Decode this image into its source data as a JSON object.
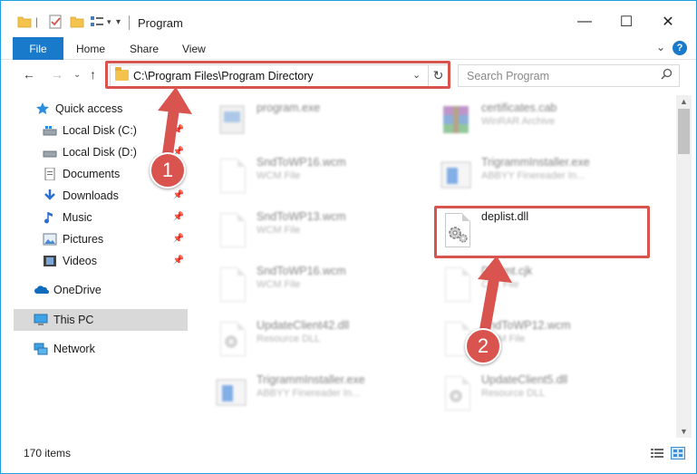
{
  "window": {
    "title": "Program",
    "minimize": "—",
    "maximize": "☐",
    "close": "✕"
  },
  "ribbon": {
    "tabs": [
      "File",
      "Home",
      "Share",
      "View"
    ],
    "help": "?"
  },
  "address": {
    "path": "C:\\Program Files\\Program Directory",
    "search_placeholder": "Search Program"
  },
  "nav": {
    "items": [
      {
        "label": "Quick access",
        "icon": "star-icon"
      },
      {
        "label": "Local Disk (C:)",
        "icon": "drive-icon"
      },
      {
        "label": "Local Disk (D:)",
        "icon": "drive-icon"
      },
      {
        "label": "Documents",
        "icon": "documents-icon"
      },
      {
        "label": "Downloads",
        "icon": "download-icon"
      },
      {
        "label": "Music",
        "icon": "music-icon"
      },
      {
        "label": "Pictures",
        "icon": "pictures-icon"
      },
      {
        "label": "Videos",
        "icon": "videos-icon"
      },
      {
        "label": "OneDrive",
        "icon": "cloud-icon"
      },
      {
        "label": "This PC",
        "icon": "computer-icon"
      },
      {
        "label": "Network",
        "icon": "network-icon"
      }
    ]
  },
  "files": [
    {
      "name": "program.exe",
      "desc": ""
    },
    {
      "name": "certificates.cab",
      "desc": "WinRAR Archive"
    },
    {
      "name": "SndToWP16.wcm",
      "desc": "WCM File"
    },
    {
      "name": "TrigrammInstaller.exe",
      "desc": "ABBYY Finereader In..."
    },
    {
      "name": "SndToWP13.wcm",
      "desc": "WCM File"
    },
    {
      "name": "deplist.dll",
      "desc": ""
    },
    {
      "name": "SndToWP16.wcm",
      "desc": "WCM File"
    },
    {
      "name": "Defrmt.cjk",
      "desc": "CJK File"
    },
    {
      "name": "UpdateClient42.dll",
      "desc": "Resource DLL"
    },
    {
      "name": "SndToWP12.wcm",
      "desc": "WCM File"
    },
    {
      "name": "TrigrammInstaller.exe",
      "desc": "ABBYY Finereader In..."
    },
    {
      "name": "UpdateClient5.dll",
      "desc": "Resource DLL"
    }
  ],
  "status": {
    "count": "170 items"
  },
  "callouts": [
    "1",
    "2"
  ],
  "colors": {
    "accent": "#1979ca",
    "highlight": "#d9534f"
  }
}
